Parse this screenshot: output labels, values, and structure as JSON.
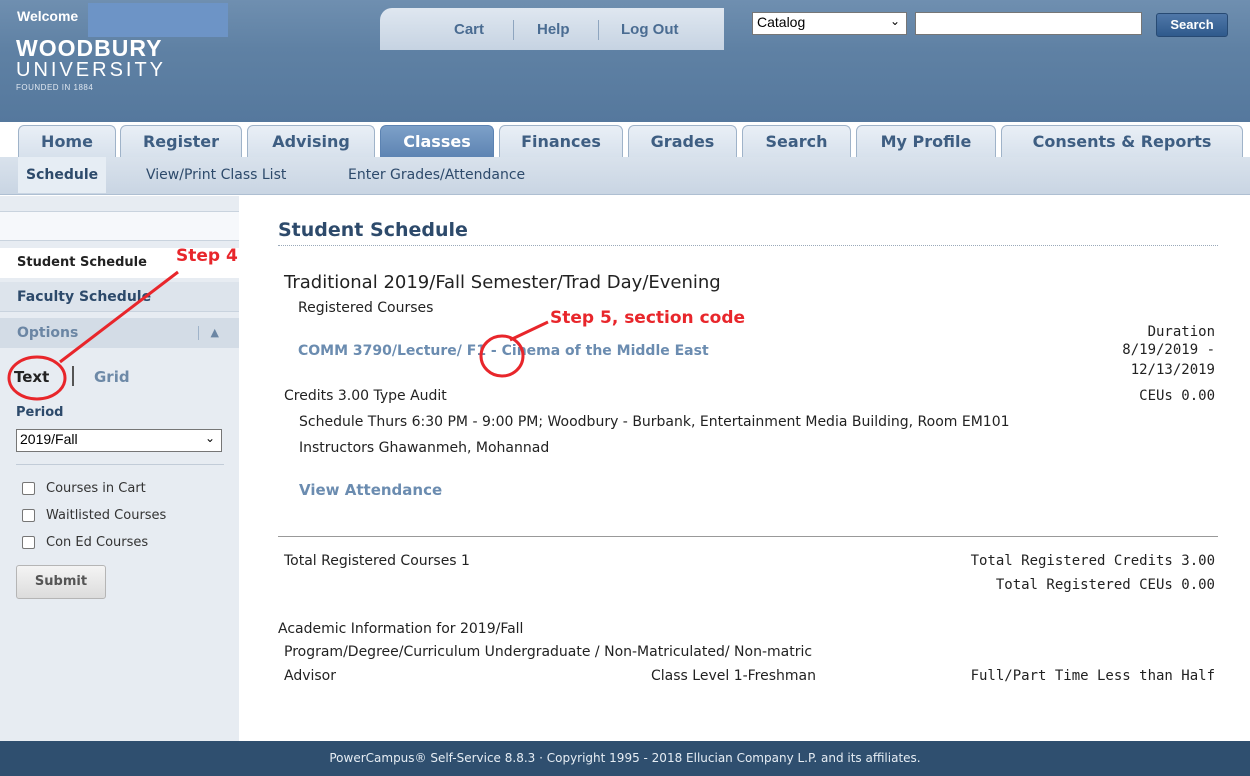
{
  "header": {
    "welcome": "Welcome",
    "logo_name": "WOODBURY",
    "logo_sub": "UNIVERSITY",
    "logo_founded": "FOUNDED IN 1884",
    "toplinks": [
      "Cart",
      "Help",
      "Log Out"
    ],
    "search": {
      "catalog_value": "Catalog",
      "input_value": "",
      "button_label": "Search"
    }
  },
  "tabs": [
    "Home",
    "Register",
    "Advising",
    "Classes",
    "Finances",
    "Grades",
    "Search",
    "My Profile",
    "Consents & Reports"
  ],
  "active_tab": "Classes",
  "subnav": [
    "Schedule",
    "View/Print Class List",
    "Enter Grades/Attendance"
  ],
  "sidebar": {
    "items": [
      "Student Schedule",
      "Faculty Schedule"
    ],
    "options_label": "Options",
    "view_text": "Text",
    "view_grid": "Grid",
    "period_label": "Period",
    "period_value": "2019/Fall",
    "checkboxes": [
      "Courses in Cart",
      "Waitlisted Courses",
      "Con Ed Courses"
    ],
    "submit_label": "Submit"
  },
  "main": {
    "title": "Student Schedule",
    "term": "Traditional 2019/Fall Semester/Trad Day/Evening",
    "registered_courses": "Registered Courses",
    "course": {
      "code": "COMM 3790/Lecture/ F1 - Cinema of the Middle East",
      "duration_label": "Duration",
      "duration_start": "8/19/2019 -",
      "duration_end": "12/13/2019",
      "credits_type": "Credits 3.00  Type Audit",
      "ceus": "CEUs 0.00",
      "schedule": "Schedule Thurs 6:30 PM - 9:00 PM;  Woodbury - Burbank, Entertainment Media Building, Room EM101",
      "instructors": "Instructors Ghawanmeh, Mohannad",
      "view_attendance": "View Attendance"
    },
    "totals": {
      "courses": "Total Registered Courses 1",
      "credits": "Total Registered Credits 3.00",
      "ceus": "Total Registered CEUs 0.00"
    },
    "academic": {
      "heading": "Academic Information for 2019/Fall",
      "program": "Program/Degree/Curriculum Undergraduate / Non-Matriculated/ Non-matric",
      "advisor": "Advisor",
      "class_level": "Class Level 1-Freshman",
      "full_part": "Full/Part Time Less than Half"
    }
  },
  "annotations": {
    "step4": "Step 4",
    "step5": "Step 5, section code",
    "color": "#e8262b"
  },
  "footer": "PowerCampus® Self-Service 8.8.3 · Copyright 1995 - 2018 Ellucian Company L.P. and its affiliates."
}
